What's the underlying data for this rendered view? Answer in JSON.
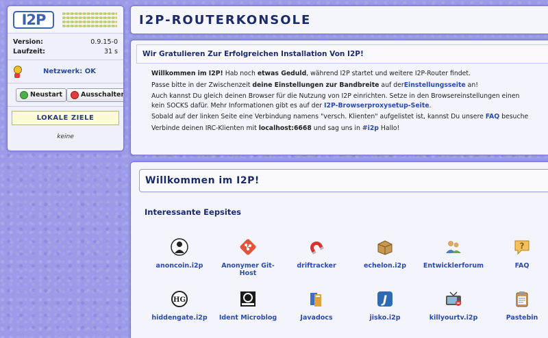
{
  "sidebar": {
    "logo_text": "I2P",
    "version_label": "Version:",
    "version_value": "0.9.15-0",
    "uptime_label": "Laufzeit:",
    "uptime_value": "31 s",
    "network_status": "Netzwerk: OK",
    "restart_label": "Neustart",
    "shutdown_label": "Ausschalten",
    "local_destinations_label": "LOKALE ZIELE",
    "local_destinations_value": "keine"
  },
  "header": {
    "title": "I2P-ROUTERKONSOLE"
  },
  "welcome_panel": {
    "heading": "Wir Gratulieren Zur Erfolgreichen Installation Von I2P!",
    "line1_bold": "Willkommen im I2P!",
    "line1_a": " Hab noch ",
    "line1_bold2": "etwas Geduld",
    "line1_b": ", während I2P startet und weitere I2P-Router findet.",
    "line2_a": "Passe bitte in der Zwischenzeit ",
    "line2_bold": "deine Einstellungen zur Bandbreite",
    "line2_b": " auf der",
    "line2_link": "Einstellungsseite",
    "line2_c": " an!",
    "line3_a": "Auch kannst Du gleich deinen Browser für die Nutzung von I2P einrichten. Setze in den Browsereinstellungen einen",
    "line3_b": "kein SOCKS dafür. Mehr Informationen gibt es auf der ",
    "line3_link": "I2P-Browserproxysetup-Seite",
    "line3_c": ".",
    "line4_a": "Sobald auf der linken Seite eine Verbindung namens \"versch. Klienten\" aufgelistet ist, kannst Du unsere ",
    "line4_link": "FAQ",
    "line4_b": " besuche",
    "line5_a": "Verbinde deinen IRC-Klienten mit ",
    "line5_bold": "localhost:6668",
    "line5_b": " und sag uns in ",
    "line5_link": "#i2p",
    "line5_c": " Hallo!"
  },
  "main_panel": {
    "heading": "Willkommen im I2P!",
    "eepsites_title": "Interessante Eepsites",
    "eepsites": [
      {
        "label": "anoncoin.i2p",
        "icon": "anoncoin-icon"
      },
      {
        "label": "Anonymer Git-Host",
        "icon": "git-icon"
      },
      {
        "label": "driftracker",
        "icon": "magnet-icon"
      },
      {
        "label": "echelon.i2p",
        "icon": "box-icon"
      },
      {
        "label": "Entwicklerforum",
        "icon": "users-icon"
      },
      {
        "label": "FAQ",
        "icon": "help-icon"
      },
      {
        "label": "hiddengate.i2p",
        "icon": "hiddengate-icon"
      },
      {
        "label": "Ident Microblog",
        "icon": "ident-icon"
      },
      {
        "label": "Javadocs",
        "icon": "books-icon"
      },
      {
        "label": "jisko.i2p",
        "icon": "jisko-icon"
      },
      {
        "label": "killyourtv.i2p",
        "icon": "tv-icon"
      },
      {
        "label": "Pastebin",
        "icon": "clipboard-icon"
      }
    ]
  },
  "colors": {
    "background": "#9b9be8",
    "panel": "#f3f4fc",
    "heading": "#1b2a6b",
    "link": "#2a4ab0"
  }
}
